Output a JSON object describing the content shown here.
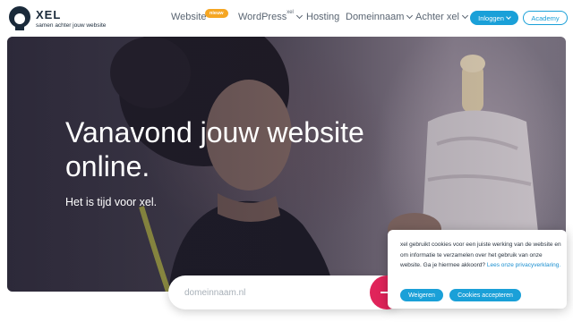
{
  "header": {
    "brand": "XEL",
    "tagline": "samen achter jouw website",
    "nav": {
      "website": "Website",
      "website_badge": "nieuw",
      "wordpress": "WordPress",
      "wordpress_sup": "xel",
      "hosting": "Hosting",
      "domeinnaam": "Domeinnaam",
      "achter_xel": "Achter xel"
    },
    "login_label": "Inloggen",
    "academy_label": "Academy"
  },
  "hero": {
    "title": "Vanavond jouw website online.",
    "subtitle": "Het is tijd voor xel."
  },
  "domain_search": {
    "placeholder": "domeinnaam.nl"
  },
  "cookie_banner": {
    "text": "xel gebruikt cookies voor een juiste werking van de website en om informatie te verzamelen over het gebruik van onze website. Ga je hiermee akkoord?",
    "privacy_link": "Lees onze privacyverklaring.",
    "deny_label": "Weigeren",
    "accept_label": "Cookies accepteren"
  },
  "colors": {
    "accent": "#1aa0d8",
    "badge": "#f5a623",
    "search_button": "#e0245a"
  },
  "icons": {
    "logo": "woman-silhouette-logo",
    "search_submit": "arrow-right-icon"
  }
}
